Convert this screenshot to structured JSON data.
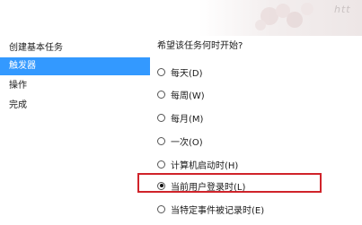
{
  "watermark": "htt",
  "sidebar": {
    "items": [
      {
        "label": "创建基本任务",
        "active": false
      },
      {
        "label": "触发器",
        "active": true
      },
      {
        "label": "操作",
        "active": false
      },
      {
        "label": "完成",
        "active": false
      }
    ]
  },
  "main": {
    "question": "希望该任务何时开始?",
    "options": [
      {
        "label": "每天(D)",
        "checked": false
      },
      {
        "label": "每周(W)",
        "checked": false
      },
      {
        "label": "每月(M)",
        "checked": false
      },
      {
        "label": "一次(O)",
        "checked": false
      },
      {
        "label": "计算机启动时(H)",
        "checked": false
      },
      {
        "label": "当前用户登录时(L)",
        "checked": true
      },
      {
        "label": "当特定事件被记录时(E)",
        "checked": false
      }
    ]
  },
  "colors": {
    "selection": "#3399ff",
    "highlight_border": "#d0232a"
  }
}
